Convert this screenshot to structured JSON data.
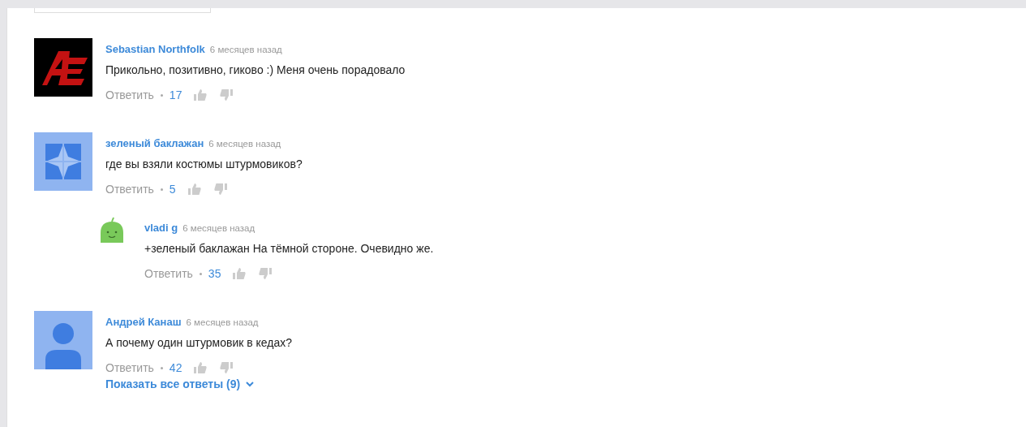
{
  "comments": [
    {
      "author": "Sebastian Northfolk",
      "time": "6 месяцев назад",
      "text": "Прикольно, позитивно, гиково :) Меня очень порадовало",
      "reply_label": "Ответить",
      "likes": "17",
      "avatar": {
        "kind": "logo"
      }
    },
    {
      "author": "зеленый баклажан",
      "time": "6 месяцев назад",
      "text": "где вы взяли костюмы штурмовиков?",
      "reply_label": "Ответить",
      "likes": "5",
      "avatar": {
        "kind": "pattern"
      },
      "replies": [
        {
          "author": "vladi g",
          "time": "6 месяцев назад",
          "text": "+зеленый баклажан На тёмной стороне. Очевидно же.",
          "reply_label": "Ответить",
          "likes": "35",
          "avatar": {
            "kind": "android"
          }
        }
      ]
    },
    {
      "author": "Андрей Канаш",
      "time": "6 месяцев назад",
      "text": "А почему один штурмовик в кедах?",
      "reply_label": "Ответить",
      "likes": "42",
      "avatar": {
        "kind": "silhouette"
      }
    }
  ],
  "show_replies": "Показать все ответы (9)"
}
